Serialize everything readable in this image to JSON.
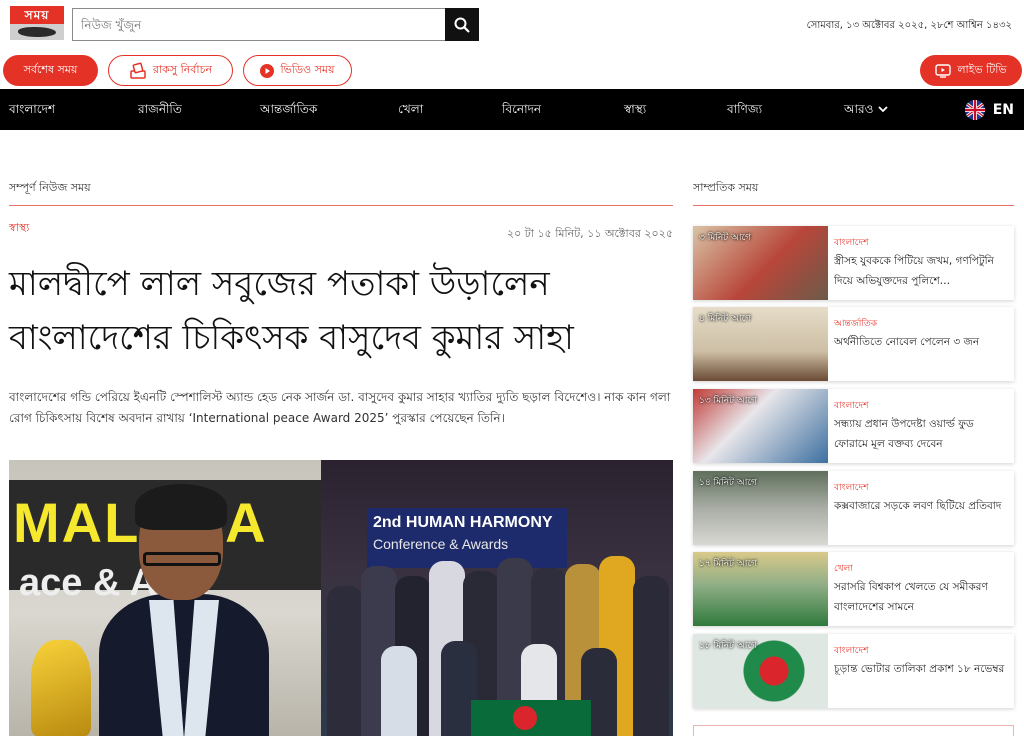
{
  "header": {
    "logo_text": "সময়",
    "search_placeholder": "নিউজ খুঁজুন",
    "date_text": "সোমবার, ১৩ অক্টোবর ২০২৫, ২৮শে আশ্বিন ১৪৩২"
  },
  "pills": {
    "latest": "সর্বশেষ সময়",
    "election": "রাকসু নির্বাচন",
    "video": "ভিডিও সময়",
    "live_tv": "লাইভ টিভি"
  },
  "nav": {
    "items": [
      "বাংলাদেশ",
      "রাজনীতি",
      "আন্তর্জাতিক",
      "খেলা",
      "বিনোদন",
      "স্বাস্থ্য",
      "বাণিজ্য",
      "আরও"
    ],
    "lang": "EN"
  },
  "article": {
    "section_title": "সম্পূর্ণ নিউজ সময়",
    "category": "স্বাস্থ্য",
    "published": "২০ টা ১৫ মিনিট, ১১ অক্টোবর ২০২৫",
    "headline": "মালদ্বীপে লাল সবুজের পতাকা উড়ালেন বাংলাদেশের চিকিৎসক বাসুদেব কুমার সাহা",
    "summary": "বাংলাদেশের গন্ডি পেরিয়ে ইএনটি স্পেশালিস্ট অ্যান্ড হেড নেক সার্জন ডা. বাসুদেব কুমার সাহার খ্যাতির দ্যুতি ছড়াল বিদেশেও। নাক কান গলা রোগ চিকিৎসায় বিশেষ অবদান রাখায় ‘International peace Award 2025’ পুরস্কার পেয়েছেন তিনি।",
    "photo_left_banner": [
      "MALDHA",
      "ace & Awa"
    ],
    "photo_stage_text": [
      "2nd HUMAN HARMONY",
      "Conference & Awards"
    ]
  },
  "sidebar": {
    "title": "সাম্প্রতিক সময়",
    "cards": [
      {
        "time": "৩ মিনিট আগে",
        "category": "বাংলাদেশ",
        "title": "স্ত্রীসহ যুবককে পিটিয়ে জখম, গণপিটুনি দিয়ে অভিযুক্তদের পুলিশে…",
        "thumb_color": "#b8463a"
      },
      {
        "time": "৪ মিনিট আগে",
        "category": "আন্তর্জাতিক",
        "title": "অর্থনীতিতে নোবেল পেলেন ৩ জন",
        "thumb_color": "#6b4a34"
      },
      {
        "time": "১৩ মিনিট আগে",
        "category": "বাংলাদেশ",
        "title": "সন্ধ্যায় প্রধান উপদেষ্টা ওয়ার্ল্ড ফুড ফোরামে মূল বক্তব্য দেবেন",
        "thumb_color": "#3c6fa0"
      },
      {
        "time": "১৪ মিনিট আগে",
        "category": "বাংলাদেশ",
        "title": "কক্সবাজারে সড়কে লবণ ছিটিয়ে প্রতিবাদ",
        "thumb_color": "#8a8f86"
      },
      {
        "time": "১৭ মিনিট আগে",
        "category": "খেলা",
        "title": "সরাসরি বিশ্বকাপ খেলতে যে সমীকরণ বাংলাদেশের সামনে",
        "thumb_color": "#2f7a3c"
      },
      {
        "time": "১৮ মিনিট আগে",
        "category": "বাংলাদেশ",
        "title": "চূড়ান্ত ভোটার তালিকা প্রকাশ ১৮ নভেম্বর",
        "thumb_color": "#1f8a4a"
      }
    ]
  },
  "colors": {
    "accent": "#e53227",
    "nav_bg": "#000000"
  }
}
